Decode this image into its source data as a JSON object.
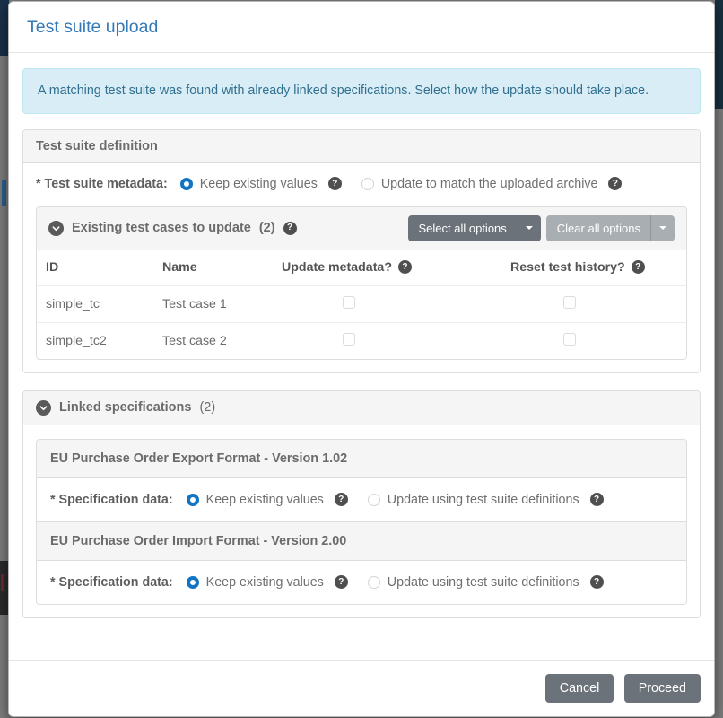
{
  "modal": {
    "title": "Test suite upload",
    "alert_message": "A matching test suite was found with already linked specifications. Select how the update should take place.",
    "footer": {
      "cancel_label": "Cancel",
      "proceed_label": "Proceed"
    }
  },
  "test_suite_definition": {
    "panel_title": "Test suite definition",
    "metadata_label": "* Test suite metadata:",
    "metadata_options": [
      {
        "label": "Keep existing values",
        "selected": true
      },
      {
        "label": "Update to match the uploaded archive",
        "selected": false
      }
    ],
    "existing_test_cases": {
      "title": "Existing test cases to update",
      "count": "(2)",
      "select_all_label": "Select all options",
      "clear_all_label": "Clear all options",
      "columns": {
        "id": "ID",
        "name": "Name",
        "update_metadata": "Update metadata?",
        "reset_history": "Reset test history?"
      },
      "rows": [
        {
          "id": "simple_tc",
          "name": "Test case 1",
          "update_metadata": false,
          "reset_history": false
        },
        {
          "id": "simple_tc2",
          "name": "Test case 2",
          "update_metadata": false,
          "reset_history": false
        }
      ]
    }
  },
  "linked_specifications": {
    "title": "Linked specifications",
    "count": "(2)",
    "items": [
      {
        "name": "EU Purchase Order Export Format - Version 1.02",
        "data_label": "* Specification data:",
        "options": [
          {
            "label": "Keep existing values",
            "selected": true
          },
          {
            "label": "Update using test suite definitions",
            "selected": false
          }
        ]
      },
      {
        "name": "EU Purchase Order Import Format - Version 2.00",
        "data_label": "* Specification data:",
        "options": [
          {
            "label": "Keep existing values",
            "selected": true
          },
          {
            "label": "Update using test suite definitions",
            "selected": false
          }
        ]
      }
    ]
  },
  "icons": {
    "help": "?",
    "chevron_down": "chevron-down-icon"
  },
  "colors": {
    "title_blue": "#337ab7",
    "alert_bg": "#d9edf7",
    "alert_border": "#bce8f1",
    "alert_text": "#31708f",
    "radio_selected": "#1275c4",
    "button_gray": "#6b727a",
    "button_light_gray": "#a9aeb3"
  }
}
